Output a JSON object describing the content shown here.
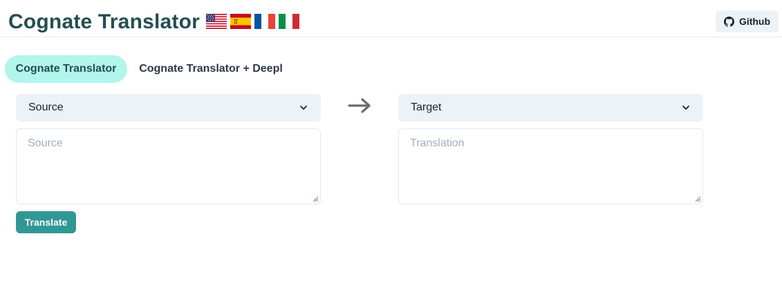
{
  "header": {
    "title": "Cognate Translator",
    "flags": [
      "us-flag-icon",
      "spain-flag-icon",
      "france-flag-icon",
      "italy-flag-icon"
    ],
    "github_label": "Github",
    "github_icon": "github-icon"
  },
  "tabs": [
    {
      "label": "Cognate Translator",
      "active": true
    },
    {
      "label": "Cognate Translator + Deepl",
      "active": false
    }
  ],
  "source": {
    "select_value": "Source",
    "textarea_placeholder": "Source"
  },
  "target": {
    "select_value": "Target",
    "textarea_placeholder": "Translation"
  },
  "direction_icon": "arrow-right-icon",
  "translate_label": "Translate",
  "colors": {
    "title": "#234e52",
    "active_tab_bg": "#b2f5ea",
    "button": "#319795",
    "input_bg": "#edf2f7"
  }
}
